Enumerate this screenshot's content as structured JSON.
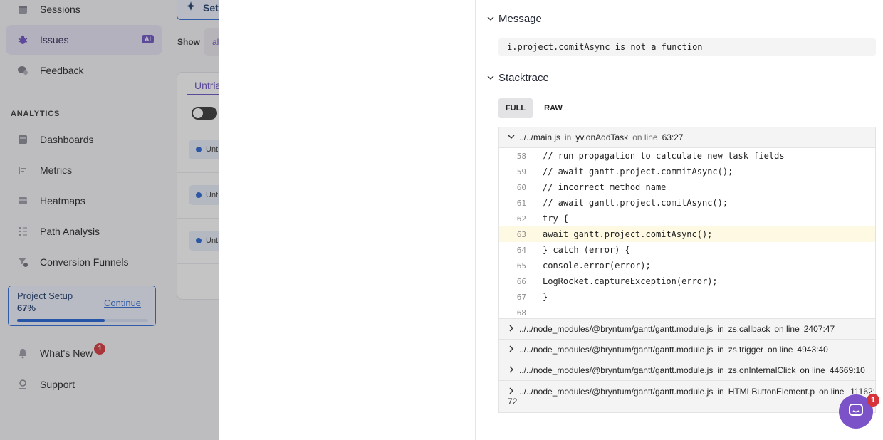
{
  "sidebar": {
    "items": [
      {
        "label": "Sessions",
        "icon": "calendar-icon"
      },
      {
        "label": "Issues",
        "icon": "bug-icon",
        "badge": "AI",
        "active": true
      },
      {
        "label": "Feedback",
        "icon": "chat-bubble-icon"
      }
    ],
    "analytics_header": "ANALYTICS",
    "analytics_items": [
      {
        "label": "Dashboards",
        "icon": "dashboard-icon"
      },
      {
        "label": "Metrics",
        "icon": "metrics-icon"
      },
      {
        "label": "Heatmaps",
        "icon": "heatmap-icon"
      },
      {
        "label": "Path Analysis",
        "icon": "path-icon"
      },
      {
        "label": "Conversion Funnels",
        "icon": "funnel-icon"
      }
    ],
    "project_setup": {
      "title": "Project Setup",
      "percent": "67%",
      "progress": 0.67,
      "continue_label": "Continue"
    },
    "whats_new": {
      "label": "What's New",
      "badge": "1"
    },
    "support": {
      "label": "Support"
    }
  },
  "middle": {
    "setup_button": "Set",
    "show_label": "Show",
    "show_value": "al",
    "tab_label": "Untria",
    "status_pills": [
      "Unt",
      "Unt",
      "Unt"
    ]
  },
  "detail": {
    "message_heading": "Message",
    "message_text": "i.project.comitAsync is not a function",
    "stacktrace_heading": "Stacktrace",
    "tabs": {
      "full": "FULL",
      "raw": "RAW"
    },
    "frames": [
      {
        "file": "../../main.js",
        "in_label": "in",
        "func": "yv.onAddTask",
        "line_label": "on line",
        "location": "63:27",
        "expanded": true
      },
      {
        "file": "../../node_modules/@bryntum/gantt/gantt.module.js",
        "in_label": "in",
        "func": "zs.callback",
        "line_label": "on line",
        "location": "2407:47"
      },
      {
        "file": "../../node_modules/@bryntum/gantt/gantt.module.js",
        "in_label": "in",
        "func": "zs.trigger",
        "line_label": "on line",
        "location": "4943:40"
      },
      {
        "file": "../../node_modules/@bryntum/gantt/gantt.module.js",
        "in_label": "in",
        "func": "zs.onInternalClick",
        "line_label": "on line",
        "location": "44669:10"
      },
      {
        "file": "../../node_modules/@bryntum/gantt/gantt.module.js",
        "in_label": "in",
        "func": "HTMLButtonElement.p",
        "line_label": "on line",
        "location_a": "11162:",
        "location_b": "72"
      }
    ],
    "code_lines": [
      {
        "num": "58",
        "text": "// run propagation to calculate new task fields"
      },
      {
        "num": "59",
        "text": "// await gantt.project.commitAsync();"
      },
      {
        "num": "60",
        "text": "// incorrect method name"
      },
      {
        "num": "61",
        "text": "// await gantt.project.comitAsync();"
      },
      {
        "num": "62",
        "text": "try {"
      },
      {
        "num": "63",
        "text": "await gantt.project.comitAsync();",
        "highlight": true
      },
      {
        "num": "64",
        "text": "} catch (error) {"
      },
      {
        "num": "65",
        "text": "console.error(error);"
      },
      {
        "num": "66",
        "text": "LogRocket.captureException(error);"
      },
      {
        "num": "67",
        "text": "}"
      },
      {
        "num": "68",
        "text": ""
      }
    ]
  },
  "chat": {
    "badge": "1"
  },
  "colors": {
    "accent": "#6a4fc2",
    "link": "#2f6bd6",
    "highlight": "#fdf9e3",
    "chat": "#7b52c8",
    "badge": "#d6343a"
  }
}
